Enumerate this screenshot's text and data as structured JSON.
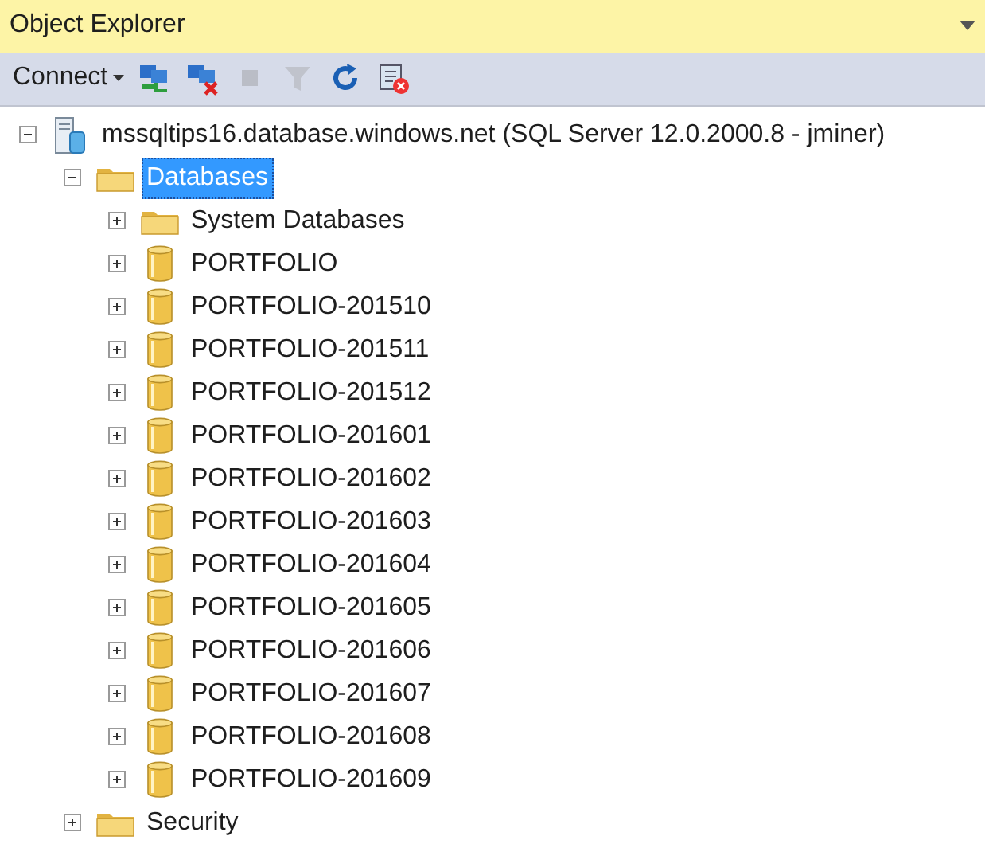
{
  "panel": {
    "title": "Object Explorer"
  },
  "toolbar": {
    "connect_label": "Connect",
    "buttons": [
      {
        "kind": "connect",
        "disabled": false
      },
      {
        "kind": "disconnect",
        "disabled": false
      },
      {
        "kind": "stop",
        "disabled": true
      },
      {
        "kind": "filter",
        "disabled": true
      },
      {
        "kind": "refresh",
        "disabled": false
      },
      {
        "kind": "stop-activity",
        "disabled": false
      }
    ]
  },
  "tree": [
    {
      "kind": "server",
      "label": "mssqltips16.database.windows.net (SQL Server 12.0.2000.8 - jminer)",
      "expanded": true,
      "selected": false,
      "children": [
        {
          "kind": "folder",
          "label": "Databases",
          "expanded": true,
          "selected": true,
          "children": [
            {
              "kind": "folder",
              "label": "System Databases",
              "expanded": false,
              "selected": false
            },
            {
              "kind": "database",
              "label": "PORTFOLIO",
              "expanded": false,
              "selected": false
            },
            {
              "kind": "database",
              "label": "PORTFOLIO-201510",
              "expanded": false,
              "selected": false
            },
            {
              "kind": "database",
              "label": "PORTFOLIO-201511",
              "expanded": false,
              "selected": false
            },
            {
              "kind": "database",
              "label": "PORTFOLIO-201512",
              "expanded": false,
              "selected": false
            },
            {
              "kind": "database",
              "label": "PORTFOLIO-201601",
              "expanded": false,
              "selected": false
            },
            {
              "kind": "database",
              "label": "PORTFOLIO-201602",
              "expanded": false,
              "selected": false
            },
            {
              "kind": "database",
              "label": "PORTFOLIO-201603",
              "expanded": false,
              "selected": false
            },
            {
              "kind": "database",
              "label": "PORTFOLIO-201604",
              "expanded": false,
              "selected": false
            },
            {
              "kind": "database",
              "label": "PORTFOLIO-201605",
              "expanded": false,
              "selected": false
            },
            {
              "kind": "database",
              "label": "PORTFOLIO-201606",
              "expanded": false,
              "selected": false
            },
            {
              "kind": "database",
              "label": "PORTFOLIO-201607",
              "expanded": false,
              "selected": false
            },
            {
              "kind": "database",
              "label": "PORTFOLIO-201608",
              "expanded": false,
              "selected": false
            },
            {
              "kind": "database",
              "label": "PORTFOLIO-201609",
              "expanded": false,
              "selected": false
            }
          ]
        },
        {
          "kind": "folder",
          "label": "Security",
          "expanded": false,
          "selected": false
        }
      ]
    }
  ]
}
